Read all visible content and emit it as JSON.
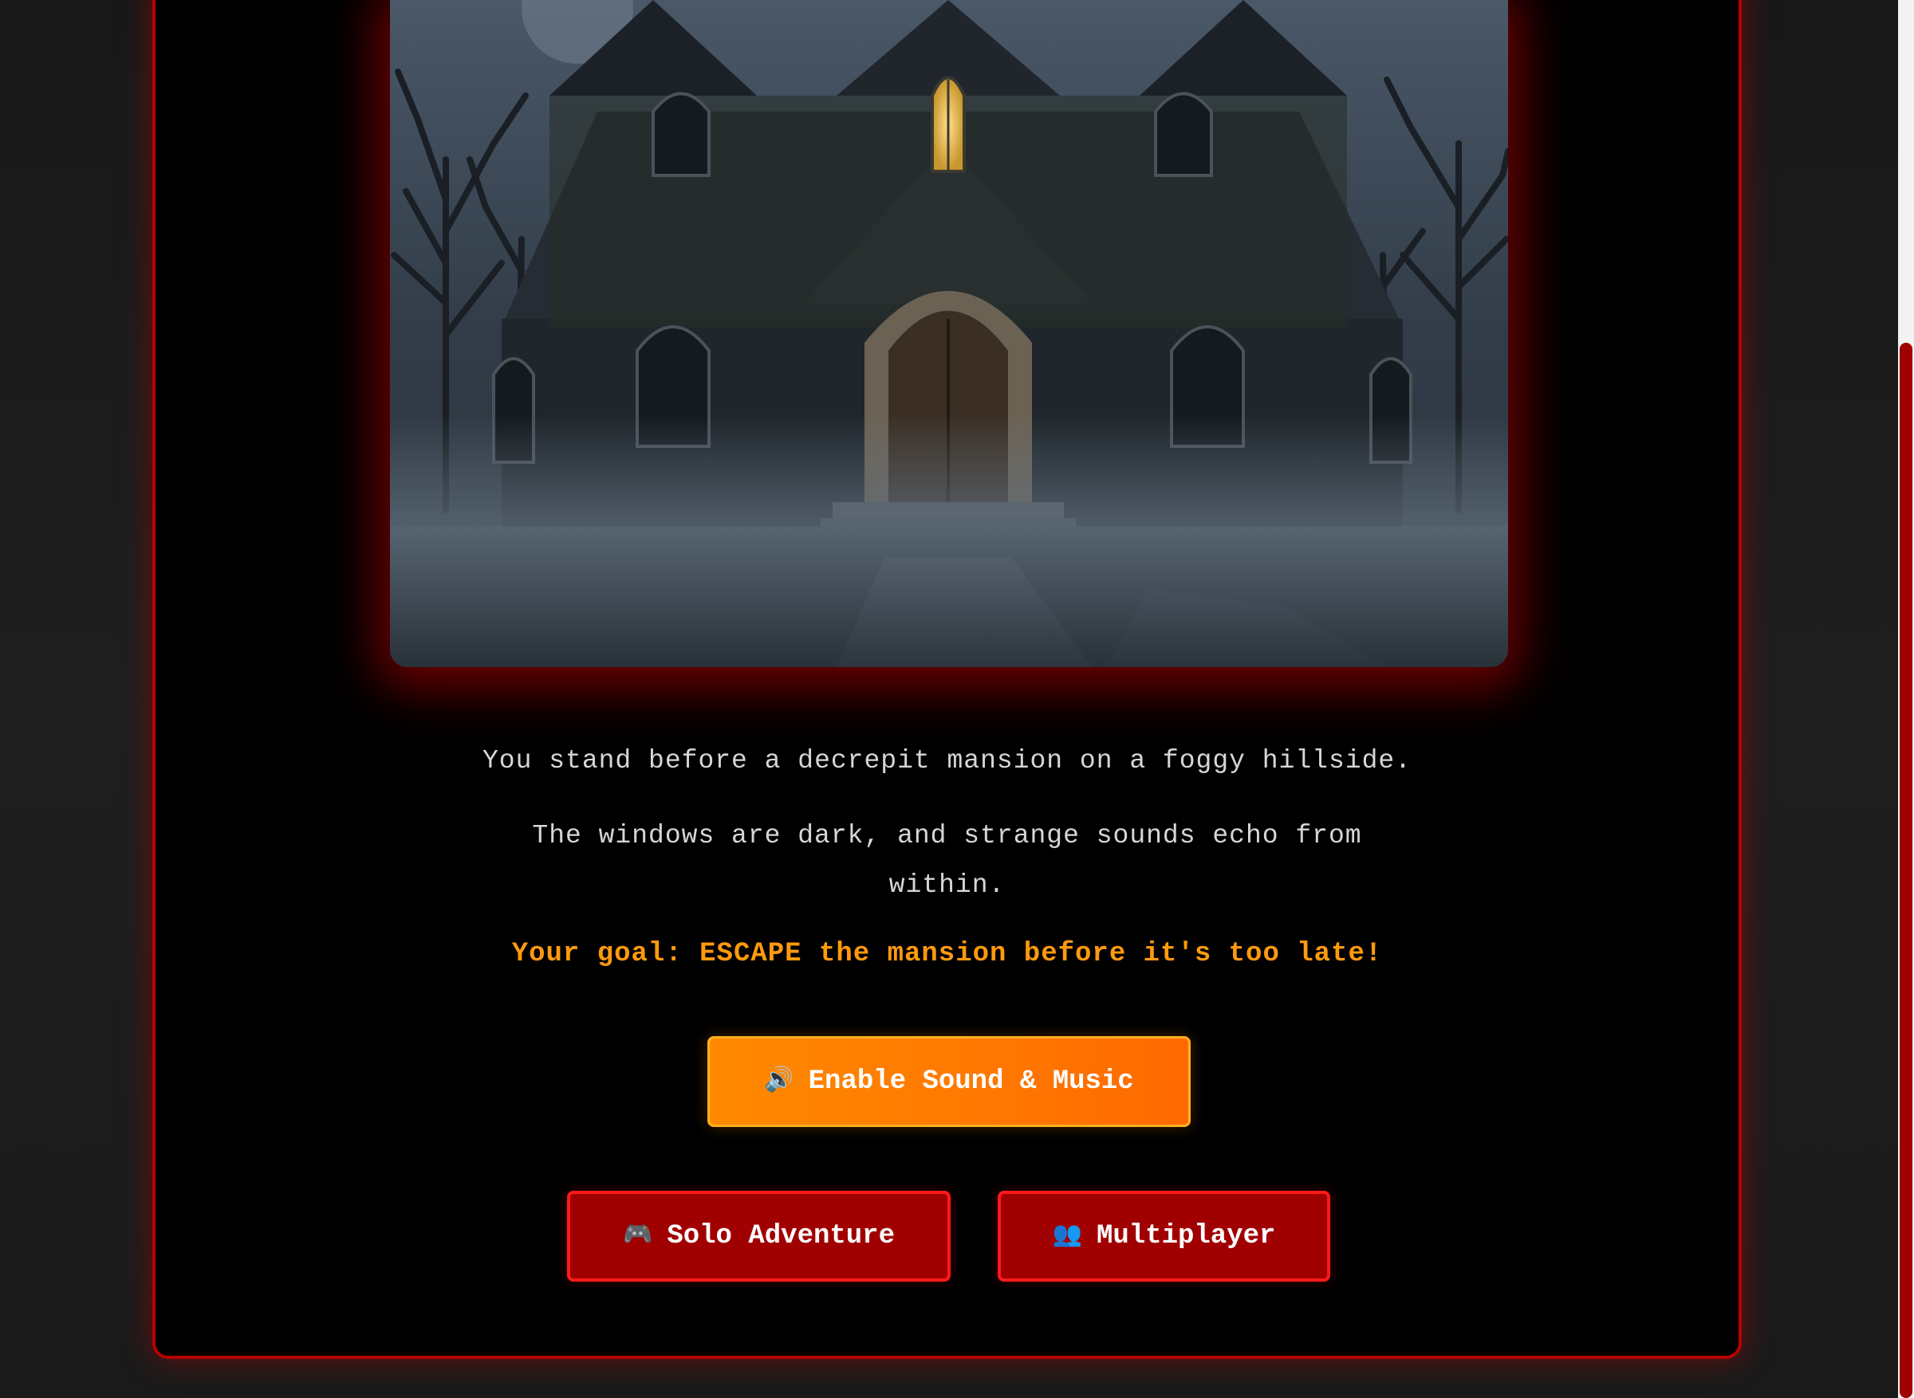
{
  "scene": {
    "image_alt": "Foggy gothic mansion at night",
    "icon": "haunted-mansion-image"
  },
  "story": {
    "line1": "You stand before a decrepit mansion on a foggy hillside.",
    "line2": "The windows are dark, and strange sounds echo from within.",
    "goal": "Your goal: ESCAPE the mansion before it's too late!"
  },
  "buttons": {
    "sound": {
      "icon": "🔊",
      "icon_name": "speaker-icon",
      "label": "Enable Sound & Music"
    },
    "solo": {
      "icon": "🎮",
      "icon_name": "gamepad-icon",
      "label": "Solo Adventure"
    },
    "multi": {
      "icon": "👥",
      "icon_name": "people-icon",
      "label": "Multiplayer"
    }
  },
  "colors": {
    "accent_red": "#b80000",
    "button_red": "#a10000",
    "button_orange": "#ff8a00",
    "goal_text": "#ff9a0d",
    "story_text": "#d6d6d6"
  }
}
